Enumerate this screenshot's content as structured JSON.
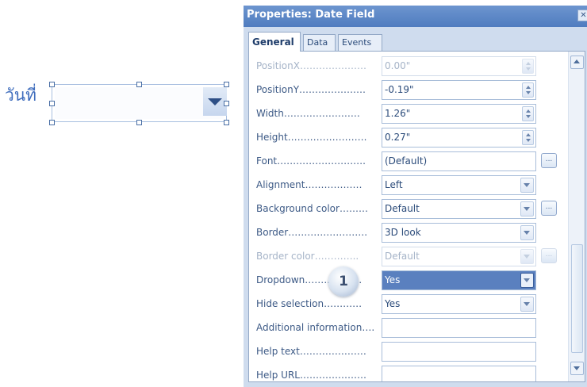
{
  "canvas": {
    "label": "วันที่"
  },
  "panel": {
    "title": "Properties: Date Field",
    "close_glyph": "✕",
    "tabs": [
      {
        "label": "General",
        "active": true
      },
      {
        "label": "Data",
        "active": false
      },
      {
        "label": "Events",
        "active": false
      }
    ],
    "rows": [
      {
        "label": "PositionX…………………",
        "value": "0.00\"",
        "control": "spin",
        "disabled": true
      },
      {
        "label": "PositionY…………………",
        "value": "-0.19\"",
        "control": "spin",
        "disabled": false
      },
      {
        "label": "Width……………………",
        "value": "1.26\"",
        "control": "spin",
        "disabled": false
      },
      {
        "label": "Height…………………….",
        "value": "0.27\"",
        "control": "spin",
        "disabled": false
      },
      {
        "label": "Font……………………….",
        "value": "(Default)",
        "control": "text",
        "ellipsis": true,
        "disabled": false
      },
      {
        "label": "Alignment………………",
        "value": "Left",
        "control": "dropdown",
        "disabled": false
      },
      {
        "label": "Background color………",
        "value": "Default",
        "control": "dropdown",
        "ellipsis": true,
        "disabled": false
      },
      {
        "label": "Border…………………….",
        "value": "3D look",
        "control": "dropdown",
        "disabled": false
      },
      {
        "label": "Border color…………..",
        "value": "Default",
        "control": "dropdown",
        "ellipsis": true,
        "disabled": true
      },
      {
        "label": "Dropdown………………",
        "value": "Yes",
        "control": "dropdown",
        "selected": true,
        "disabled": false
      },
      {
        "label": "Hide selection…………",
        "value": "Yes",
        "control": "dropdown",
        "disabled": false
      },
      {
        "label": "Additional information….",
        "value": "",
        "control": "text",
        "disabled": false
      },
      {
        "label": "Help text…………………",
        "value": "",
        "control": "text",
        "disabled": false
      },
      {
        "label": "Help URL…………………",
        "value": "",
        "control": "text",
        "disabled": false
      }
    ],
    "ellipsis_glyph": "...",
    "callout_number": "1"
  },
  "colors": {
    "title_bar": "#5b86c5",
    "panel_bg": "#cfdcee",
    "label_text": "#3d5a86",
    "selection": "#5a80bf"
  }
}
